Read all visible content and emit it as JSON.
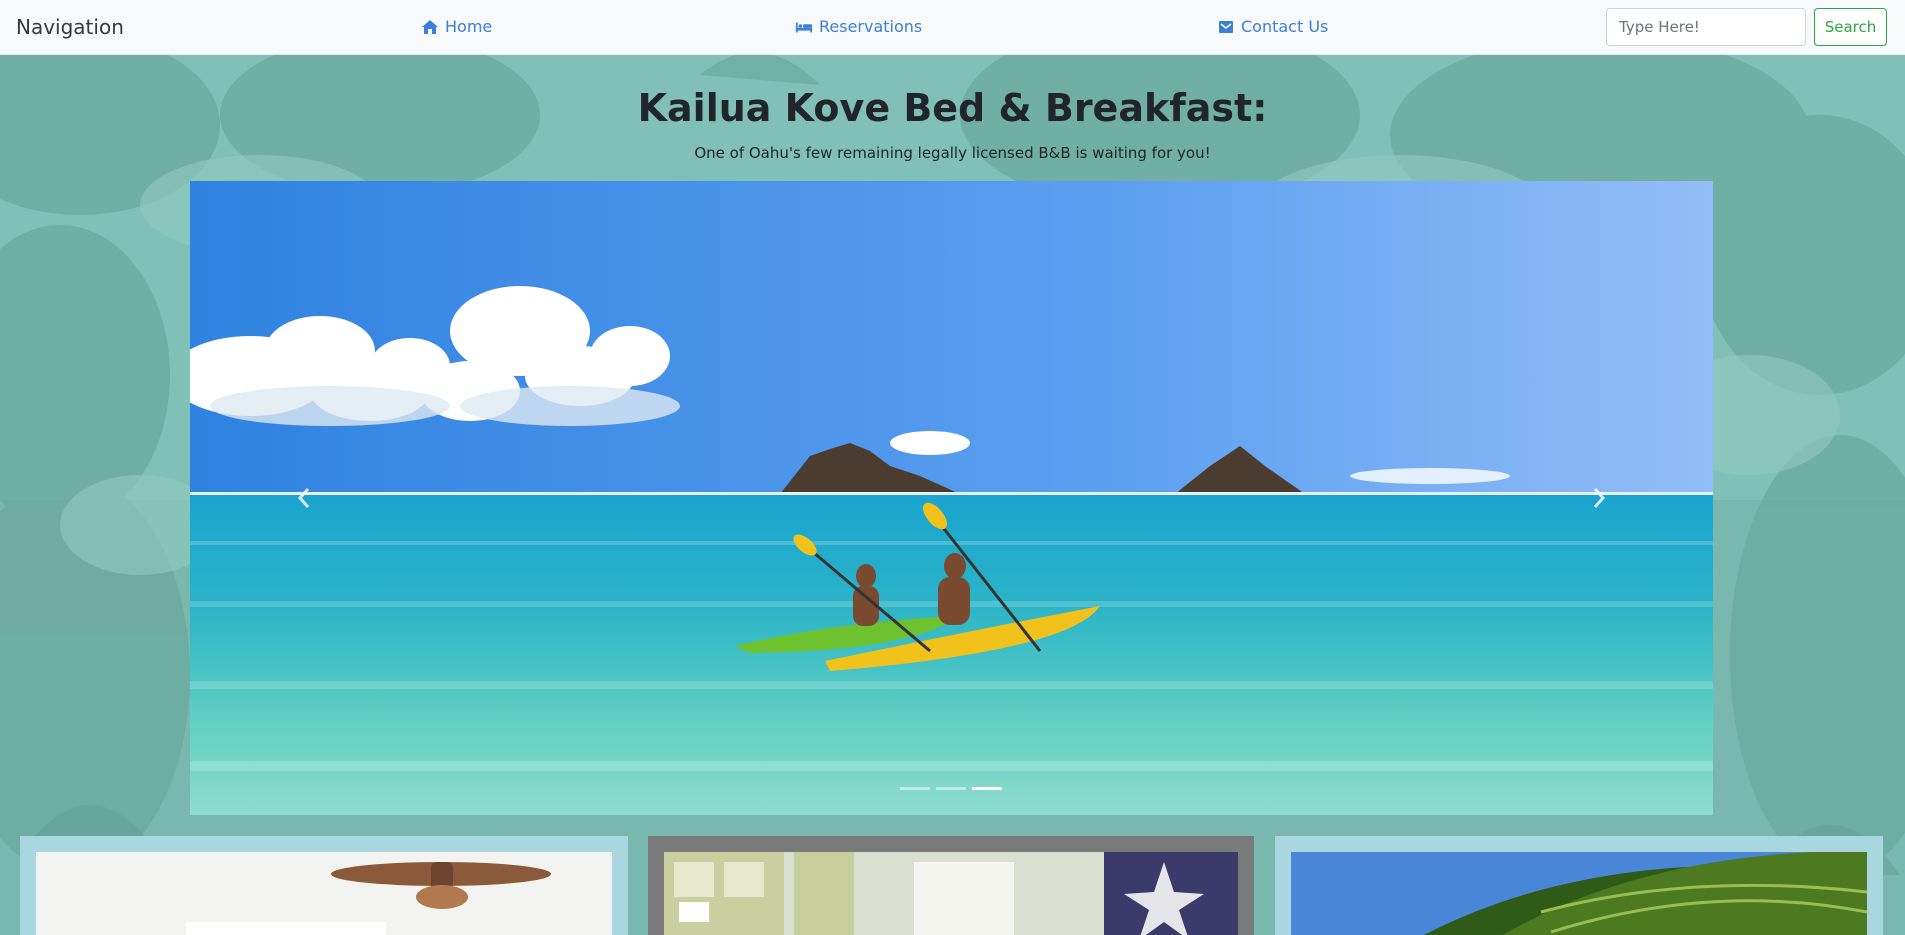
{
  "navbar": {
    "brand": "Navigation",
    "links": [
      {
        "label": "Home",
        "icon": "home-icon"
      },
      {
        "label": "Reservations",
        "icon": "bed-icon"
      },
      {
        "label": "Contact Us",
        "icon": "envelope-icon"
      }
    ],
    "search": {
      "placeholder": "Type Here!",
      "value": "",
      "button_label": "Search"
    }
  },
  "hero": {
    "title": "Kailua Kove Bed & Breakfast:",
    "subtitle": "One of Oahu's few remaining legally licensed B&B is waiting for you!"
  },
  "carousel": {
    "slide_count": 3,
    "active_index": 2,
    "prev_icon": "chevron-left-icon",
    "next_icon": "chevron-right-icon"
  },
  "cards": [
    {
      "image": "bedroom-ceiling-fan"
    },
    {
      "image": "kitchen-starfish"
    },
    {
      "image": "palm-tree"
    }
  ],
  "colors": {
    "link": "#3b7fd9",
    "search_button": "#28a745",
    "card_light": "#a9d6df",
    "card_dark": "#7a7a7a"
  }
}
